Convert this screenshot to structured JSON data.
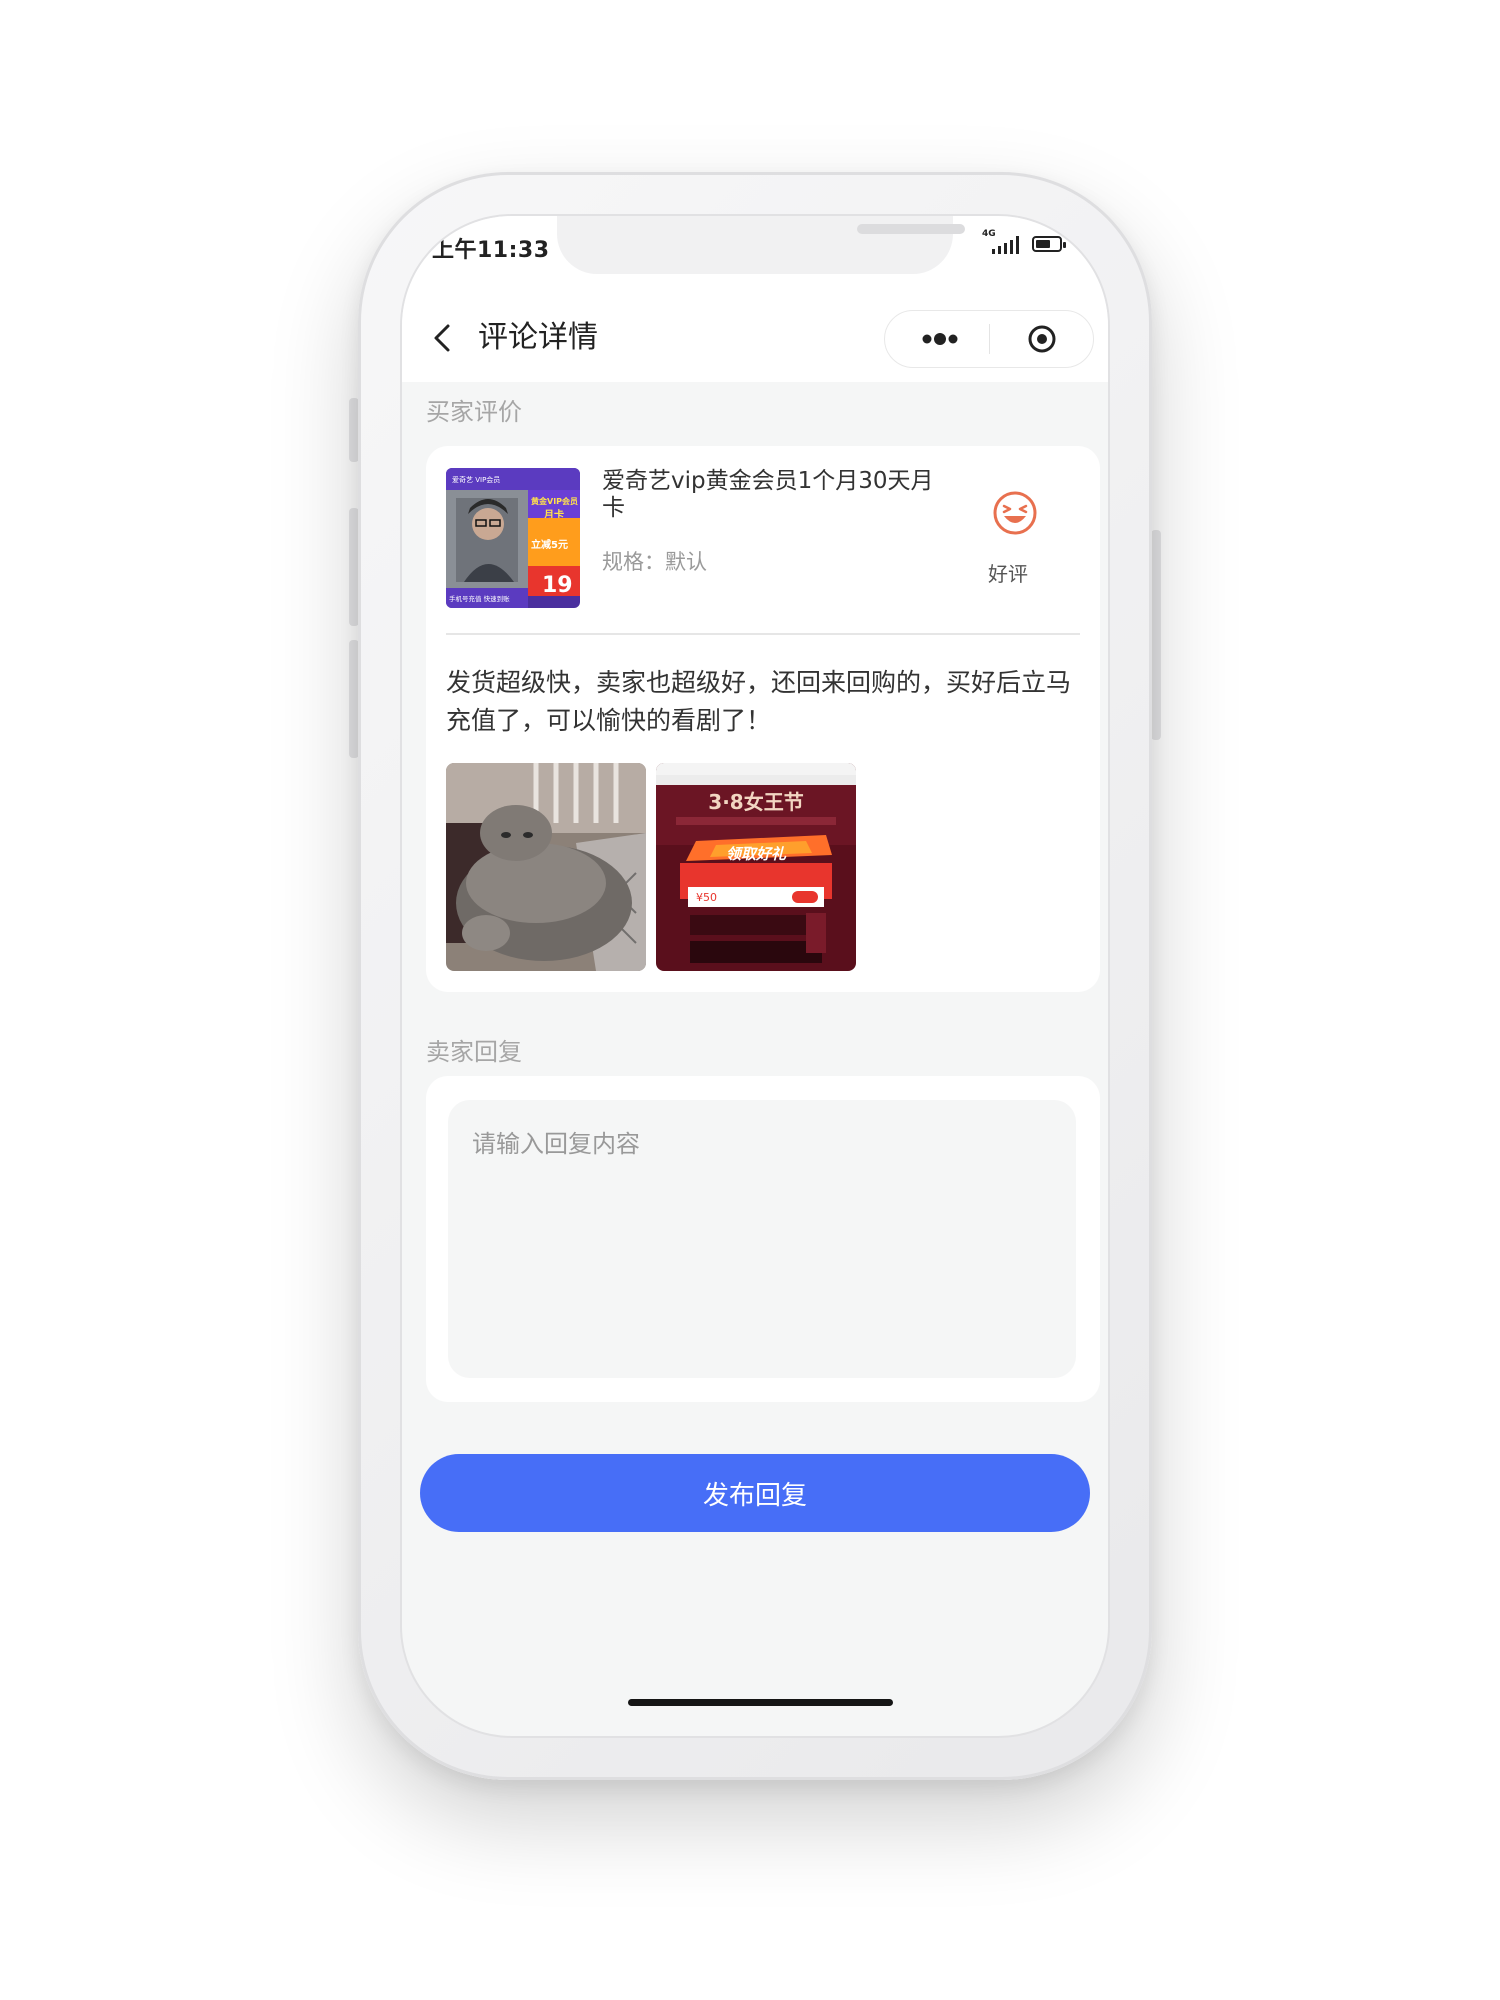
{
  "status_bar": {
    "time": "上午11:33",
    "network": "4G"
  },
  "navbar": {
    "title": "评论详情",
    "back_icon": "chevron-left-icon",
    "more_icon": "more-dots-icon",
    "target_icon": "target-circle-icon"
  },
  "buyer_review": {
    "section_label": "买家评价",
    "product": {
      "title": "爱奇艺vip黄金会员1个月30天月卡",
      "spec": "规格：默认",
      "thumb_text": {
        "brand": "爱奇艺 VIP会员",
        "headline": "黄金VIP会员",
        "subline": "月卡",
        "discount": "立减5元",
        "price": "19",
        "footer": "手机号充值 快速到账"
      }
    },
    "rating": {
      "label": "好评",
      "icon": "laughing-face-icon",
      "color": "#e8704f"
    },
    "content": "发货超级快，卖家也超级好，还回来回购的，买好后立马充值了，可以愉快的看剧了！",
    "images": [
      {
        "description_icon": "cat-photo"
      },
      {
        "description_icon": "promo-screenshot",
        "banner_text": "3·8女王节",
        "promo_text": "领取好礼",
        "coupon": "¥50"
      }
    ]
  },
  "seller_reply": {
    "section_label": "卖家回复",
    "placeholder": "请输入回复内容",
    "value": ""
  },
  "submit": {
    "label": "发布回复",
    "color": "#476ef7"
  }
}
